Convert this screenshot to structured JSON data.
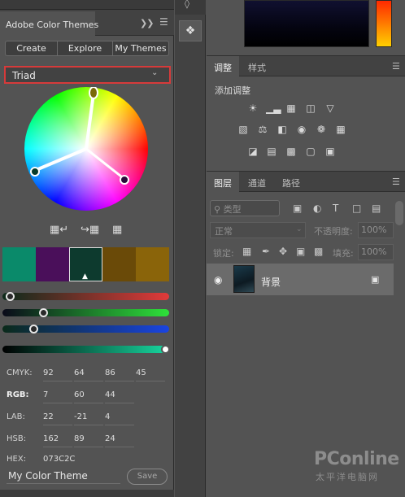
{
  "left_panel": {
    "tab_title": "Adobe Color Themes",
    "tab_expand_icon": "double-chevron-right-icon",
    "tab_menu_icon": "panel-menu-icon",
    "segments": [
      {
        "label": "Create"
      },
      {
        "label": "Explore"
      },
      {
        "label": "My Themes"
      }
    ],
    "rule_dropdown": {
      "value": "Triad",
      "icon": "chevron-down-icon"
    },
    "tools": [
      "add-color-to-swatches-icon",
      "set-base-color-icon",
      "grid-swatch-icon"
    ],
    "swatches": [
      "#0a8a6a",
      "#4a0f5a",
      "#0d3a2e",
      "#6a4a08",
      "#8a640a"
    ],
    "active_swatch_index": 2,
    "sliders": [
      {
        "name": "red",
        "value": 7,
        "gradient_end": "#e23a3a"
      },
      {
        "name": "green",
        "value": 60,
        "gradient_end": "#2ee23a"
      },
      {
        "name": "blue",
        "value": 44,
        "gradient_end": "#1a44e2"
      }
    ],
    "lightness_slider": {
      "gradient_end": "#17d8a0"
    },
    "values": {
      "cmyk": {
        "label": "CMYK:",
        "v": [
          "92",
          "64",
          "86",
          "45"
        ]
      },
      "rgb": {
        "label": "RGB:",
        "v": [
          "7",
          "60",
          "44"
        ]
      },
      "lab": {
        "label": "LAB:",
        "v": [
          "22",
          "-21",
          "4"
        ]
      },
      "hsb": {
        "label": "HSB:",
        "v": [
          "162",
          "89",
          "24"
        ]
      },
      "hex": {
        "label": "HEX:",
        "v": "073C2C"
      }
    },
    "theme_name": "My Color Theme",
    "save_label": "Save"
  },
  "icon_strip": {
    "active_tool_icon": "color-themes-icon"
  },
  "adjustments_panel": {
    "tabs": [
      "调整",
      "样式"
    ],
    "title": "添加调整",
    "rows": [
      [
        "brightness-contrast-icon",
        "levels-icon",
        "curves-icon",
        "exposure-icon",
        "triangle-icon"
      ],
      [
        "vibrance-icon",
        "balance-icon",
        "black-white-icon",
        "camera-icon",
        "channel-mixer-icon",
        "grid-lookup-icon"
      ],
      [
        "invert-icon",
        "posterize-icon",
        "threshold-icon",
        "selective-color-icon",
        "gradient-map-icon"
      ]
    ]
  },
  "layers_panel": {
    "tabs": [
      "图层",
      "通道",
      "路径"
    ],
    "filter_placeholder": "类型",
    "blend_mode": "正常",
    "opacity_label": "不透明度:",
    "opacity_value": "100%",
    "lock_label": "锁定:",
    "fill_label": "填充:",
    "fill_value": "100%",
    "layer_name": "背景"
  },
  "watermark": {
    "brand": "PConline",
    "sub": "太平洋电脑网"
  },
  "colors": {
    "accent_red": "#d63a3a",
    "panel_bg": "#535353"
  }
}
